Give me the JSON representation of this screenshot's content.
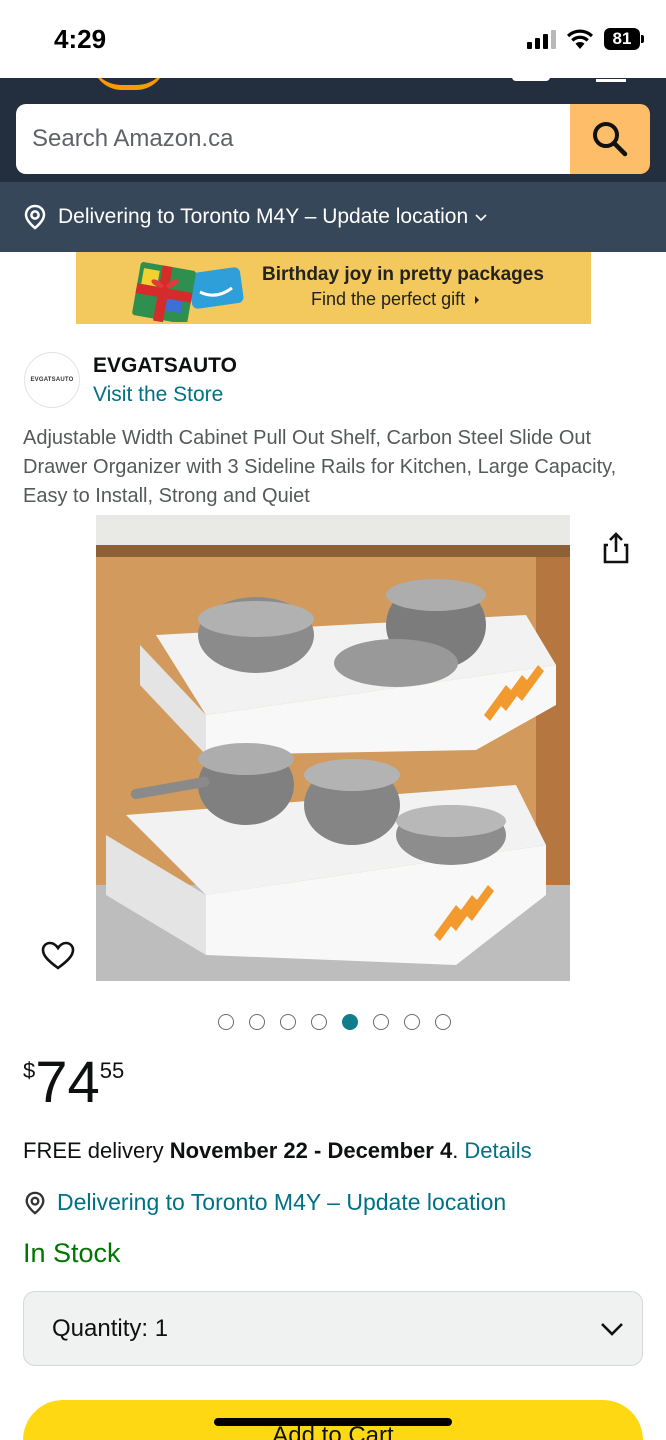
{
  "status_bar": {
    "time": "4:29",
    "battery": "81"
  },
  "search": {
    "placeholder": "Search Amazon.ca"
  },
  "location_bar": {
    "text": "Delivering to Toronto M4Y – Update location"
  },
  "promo": {
    "title": "Birthday joy in pretty packages",
    "subtitle": "Find the perfect gift"
  },
  "store": {
    "logo_text": "EVGATSAUTO",
    "name": "EVGATSAUTO",
    "visit_label": "Visit the Store"
  },
  "product": {
    "title": "Adjustable Width Cabinet Pull Out Shelf, Carbon Steel Slide Out Drawer Organizer with 3 Sideline Rails for Kitchen, Large Capacity, Easy to Install, Strong and Quiet"
  },
  "carousel": {
    "total_images": 8,
    "active_index": 4
  },
  "price": {
    "symbol": "$",
    "whole": "74",
    "fraction": "55"
  },
  "delivery": {
    "prefix": "FREE delivery ",
    "dates": "November 22 - December 4",
    "suffix": ". ",
    "details_link": "Details"
  },
  "deliver_to": {
    "text": "Delivering to Toronto M4Y – Update location"
  },
  "stock": {
    "status": "In Stock"
  },
  "quantity": {
    "label": "Quantity:",
    "value": "1"
  },
  "add_to_cart": {
    "label": "Add to Cart"
  },
  "colors": {
    "header": "#232f3e",
    "location_bar": "#37475a",
    "search_button": "#febd69",
    "link": "#007185",
    "in_stock": "#007600",
    "add_to_cart": "#ffd814",
    "dot_active": "#127c8a"
  },
  "icons": [
    "search-icon",
    "location-pin-icon",
    "chevron-down-icon",
    "share-icon",
    "heart-icon",
    "gift-icon"
  ]
}
